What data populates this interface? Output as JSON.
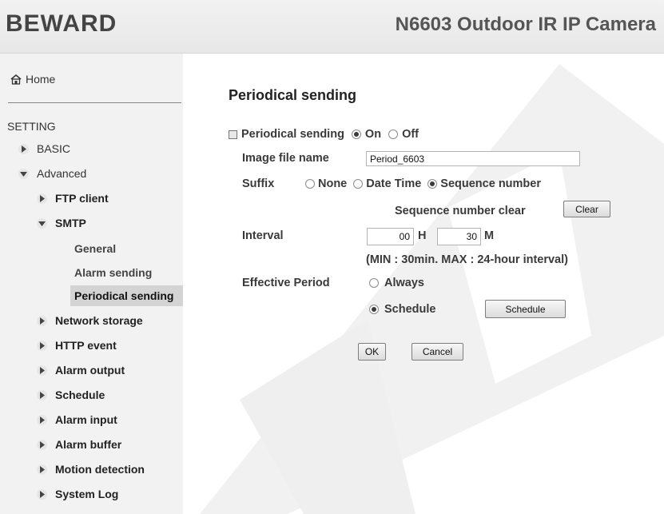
{
  "header": {
    "logo": "BEWARD",
    "camera_title": "N6603 Outdoor IR IP Camera"
  },
  "sidebar": {
    "home_label": "Home",
    "setting_label": "SETTING",
    "basic_label": "BASIC",
    "advanced_label": "Advanced",
    "ftp_label": "FTP client",
    "smtp_label": "SMTP",
    "smtp_general_label": "General",
    "smtp_alarm_label": "Alarm sending",
    "smtp_periodical_label": "Periodical sending",
    "network_storage_label": "Network storage",
    "http_event_label": "HTTP event",
    "alarm_output_label": "Alarm output",
    "schedule_label": "Schedule",
    "alarm_input_label": "Alarm input",
    "alarm_buffer_label": "Alarm buffer",
    "motion_detection_label": "Motion detection",
    "system_log_label": "System Log"
  },
  "main": {
    "title": "Periodical sending",
    "enable_label": "Periodical sending",
    "on_label": "On",
    "off_label": "Off",
    "enabled": "On",
    "image_file_name_label": "Image file name",
    "image_file_name_value": "Period_6603",
    "suffix_label": "Suffix",
    "suffix_none_label": "None",
    "suffix_datetime_label": "Date Time",
    "suffix_sequence_label": "Sequence number",
    "suffix_selected": "Sequence number",
    "sequence_clear_label": "Sequence number clear",
    "clear_button": "Clear",
    "interval_label": "Interval",
    "interval_hours_value": "00",
    "hours_unit": "H",
    "interval_minutes_value": "30",
    "minutes_unit": "M",
    "interval_note": "(MIN : 30min. MAX : 24-hour interval)",
    "effective_period_label": "Effective Period",
    "always_label": "Always",
    "schedule_option_label": "Schedule",
    "effective_selected": "Schedule",
    "schedule_button": "Schedule",
    "ok_button": "OK",
    "cancel_button": "Cancel"
  },
  "colors": {
    "sidebar_bg": "#f2f2f2",
    "active_item_bg": "#d4d4d4",
    "watermark": "#e9e9e9"
  }
}
